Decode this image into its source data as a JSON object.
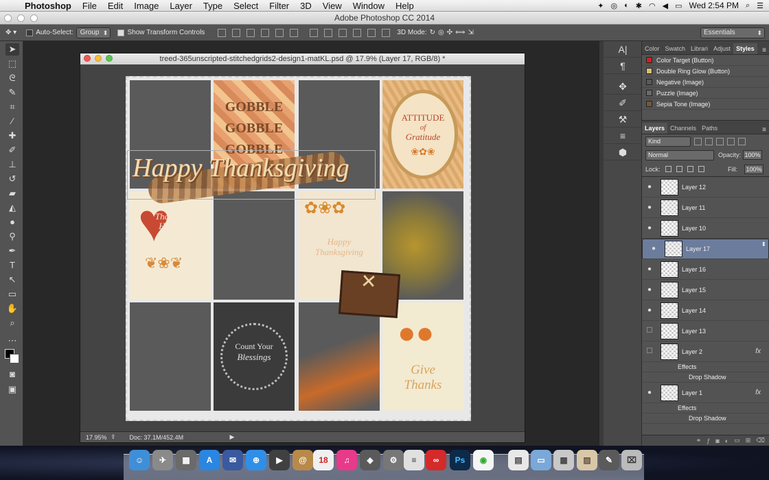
{
  "menubar": {
    "app_name": "Photoshop",
    "items": [
      "File",
      "Edit",
      "Image",
      "Layer",
      "Type",
      "Select",
      "Filter",
      "3D",
      "View",
      "Window",
      "Help"
    ],
    "clock": "Wed 2:54 PM"
  },
  "window_title": "Adobe Photoshop CC 2014",
  "options_bar": {
    "auto_select_label": "Auto-Select:",
    "auto_select_value": "Group",
    "show_transform_label": "Show Transform Controls",
    "mode_3d_label": "3D Mode:",
    "workspace": "Essentials"
  },
  "document": {
    "title": "treed-365unscripted-stitchedgrids2-design1-matKL.psd @ 17.9% (Layer 17, RGB/8) *",
    "zoom": "17.95%",
    "doc_size": "Doc: 37.1M/452.4M"
  },
  "canvas_text": {
    "gobble": "GOBBLE",
    "attitude": "ATTITUDE",
    "of": "of",
    "gratitude": "Gratitude",
    "happy_thanksgiving": "Happy Thanksgiving",
    "thankful": "Thankful",
    "hearts": "Hearts",
    "happy_small": "Happy",
    "thanksgiving_small": "Thanksgiving",
    "count_your": "Count Your",
    "blessings": "Blessings",
    "give": "Give",
    "thanks": "Thanks"
  },
  "styles_panel": {
    "tabs": [
      "Color",
      "Swatch",
      "Librari",
      "Adjust",
      "Styles"
    ],
    "active_tab": "Styles",
    "items": [
      {
        "label": "Color Target (Button)",
        "color": "#d02020"
      },
      {
        "label": "Double Ring Glow (Button)",
        "color": "#d8c070"
      },
      {
        "label": "Negative (Image)",
        "color": "#5a5a5a"
      },
      {
        "label": "Puzzle (Image)",
        "color": "#6a6a6a"
      },
      {
        "label": "Sepia Tone (Image)",
        "color": "#705a3a"
      }
    ]
  },
  "layers_panel": {
    "tabs": [
      "Layers",
      "Channels",
      "Paths"
    ],
    "kind": "Kind",
    "blend_mode": "Normal",
    "opacity_label": "Opacity:",
    "opacity": "100%",
    "lock_label": "Lock:",
    "fill_label": "Fill:",
    "fill": "100%",
    "layers": [
      "Layer 12",
      "Layer 11",
      "Layer 10",
      "Layer 17",
      "Layer 16",
      "Layer 15",
      "Layer 14",
      "Layer 13",
      "Layer 2",
      "Layer 1"
    ],
    "effects_label": "Effects",
    "drop_shadow_label": "Drop Shadow",
    "fx": "fx"
  },
  "dock": {
    "calendar_day": "18",
    "ps_label": "Ps"
  }
}
